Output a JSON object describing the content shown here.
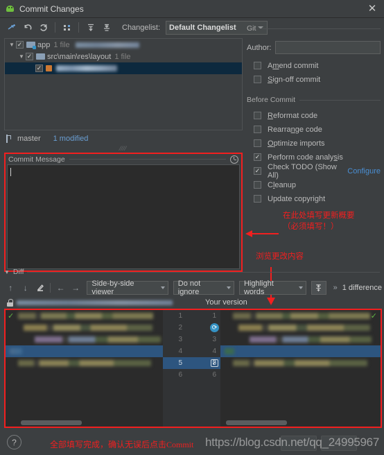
{
  "window": {
    "title": "Commit Changes",
    "app_icon": "android-studio-icon",
    "close_label": "✕"
  },
  "toolbar": {
    "icons": [
      {
        "name": "add-to-changelist-icon",
        "glyph": "⁺"
      },
      {
        "name": "rollback-icon",
        "glyph": "↺"
      },
      {
        "name": "refresh-icon",
        "glyph": "⟳"
      },
      {
        "name": "group-by-icon",
        "glyph": "⁝⁞"
      },
      {
        "name": "expand-all-icon",
        "glyph": "⇟"
      },
      {
        "name": "collapse-all-icon",
        "glyph": "⇞"
      }
    ],
    "changelist_label": "Changelist:",
    "changelist_value": "Default Changelist"
  },
  "tree": {
    "rows": [
      {
        "indent": 0,
        "twisty": "▼",
        "checked": true,
        "icon": "module-folder-icon",
        "label": "app",
        "count": "1 file",
        "blurred_suffix": true,
        "selected": false
      },
      {
        "indent": 1,
        "twisty": "▼",
        "checked": true,
        "icon": "folder-icon",
        "label": "src\\main\\res\\layout",
        "count": "1 file",
        "blurred_suffix": false,
        "selected": false
      },
      {
        "indent": 2,
        "twisty": "",
        "checked": true,
        "icon": "xml-file-icon",
        "label": "",
        "count": "",
        "blurred_suffix": true,
        "selected": true
      }
    ],
    "branch": "master",
    "modified_link": "1 modified"
  },
  "commit_message": {
    "title": "Commit Message",
    "history_icon": "clock-history-icon",
    "value": "",
    "placeholder": ""
  },
  "git_panel": {
    "group_label": "Git",
    "author_label": "Author:",
    "author_value": "",
    "options": [
      {
        "label": "Amend commit",
        "checked": false,
        "mnemonic_index": 1
      },
      {
        "label": "Sign-off commit",
        "checked": false,
        "mnemonic_index": 0
      }
    ]
  },
  "before_commit": {
    "group_label": "Before Commit",
    "options": [
      {
        "label": "Reformat code",
        "checked": false
      },
      {
        "label": "Rearrange code",
        "checked": false
      },
      {
        "label": "Optimize imports",
        "checked": false
      },
      {
        "label": "Perform code analysis",
        "checked": true
      },
      {
        "label": "Check TODO (Show All)",
        "checked": true,
        "link": "Configure"
      },
      {
        "label": "Cleanup",
        "checked": false
      },
      {
        "label": "Update copyright",
        "checked": false
      }
    ]
  },
  "annotations": {
    "commit_message_note_line1": "在此处填写更新概要",
    "commit_message_note_line2": "（必须填写！）",
    "diff_note": "浏览更改内容",
    "bottom_note": "全部填写完成，确认无误后点击Commit",
    "color": "#f21f1f"
  },
  "diff": {
    "section_label": "Diff",
    "toolbar_icons": [
      {
        "name": "previous-difference-icon",
        "glyph": "↑"
      },
      {
        "name": "next-difference-icon",
        "glyph": "↓"
      },
      {
        "name": "edit-source-icon",
        "glyph": "✎"
      },
      {
        "name": "accept-left-icon",
        "glyph": "←"
      },
      {
        "name": "accept-right-icon",
        "glyph": "→"
      }
    ],
    "viewer_mode": "Side-by-side viewer",
    "ignore_mode": "Do not ignore",
    "highlight_mode": "Highlight words",
    "collapse_icon": "collapse-unchanged-icon",
    "expand_glyph": "»",
    "difference_count": "1 difference",
    "lock_icon": "read-only-lock-icon",
    "your_version_label": "Your version",
    "line_numbers_left": [
      "1",
      "2",
      "3",
      "4",
      "5",
      "6"
    ],
    "line_numbers_right": [
      "1",
      "2",
      "3",
      "4",
      "5",
      "6"
    ],
    "highlighted_line": "5",
    "revert_icon": "revert-change-icon",
    "accept_checkbox_icon": "apply-change-checkbox",
    "ok_marker_left": "✓",
    "ok_marker_right": "✓"
  },
  "bottom": {
    "help_icon": "?",
    "watermark": "https://blog.csdn.net/qq_24995967"
  }
}
